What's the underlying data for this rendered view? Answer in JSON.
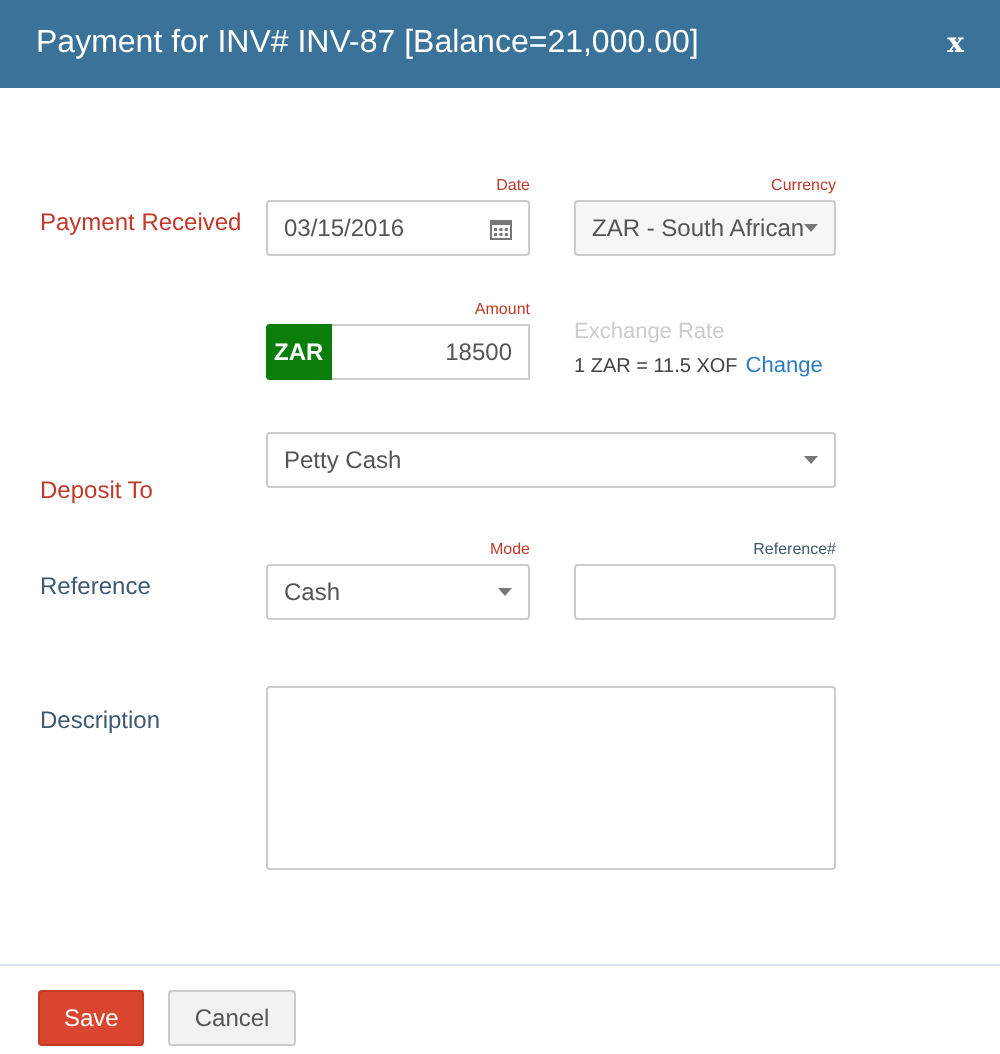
{
  "dialog": {
    "title": "Payment for INV# INV-87 [Balance=21,000.00]",
    "close": "x"
  },
  "payment_received": {
    "label": "Payment Received",
    "required": true,
    "date": {
      "caption": "Date",
      "required": true,
      "value": "03/15/2016"
    },
    "currency": {
      "caption": "Currency",
      "required": true,
      "value": "ZAR - South African"
    }
  },
  "amount": {
    "caption": "Amount",
    "required": true,
    "currency_code": "ZAR",
    "value": "18500",
    "exchange_label": "Exchange Rate",
    "rate": "1 ZAR = 11.5 XOF",
    "change_link": "Change"
  },
  "deposit_to": {
    "label": "Deposit To",
    "required": true,
    "value": "Petty Cash"
  },
  "reference": {
    "label": "Reference",
    "required": false,
    "mode": {
      "caption": "Mode",
      "required": true,
      "value": "Cash"
    },
    "number": {
      "caption": "Reference#",
      "required": false
    }
  },
  "description": {
    "label": "Description",
    "required": false
  },
  "buttons": [
    {
      "label": "Save",
      "kind": "primary"
    },
    {
      "label": "Cancel",
      "kind": "secondary"
    }
  ]
}
